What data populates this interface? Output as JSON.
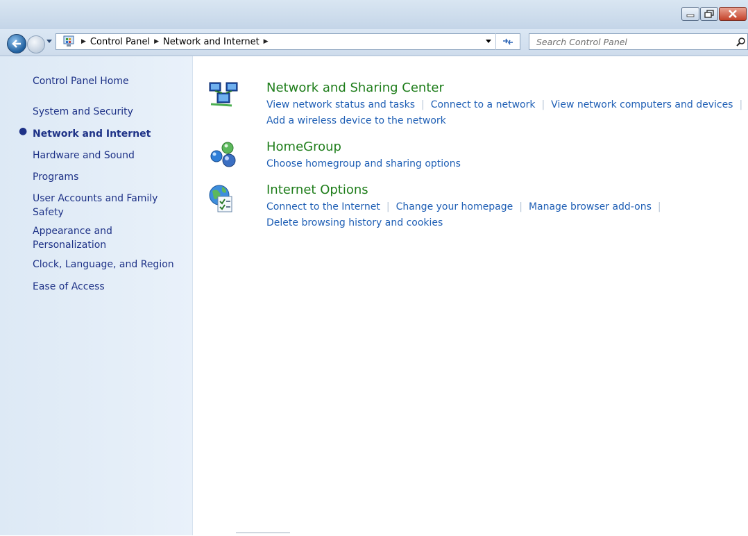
{
  "window": {
    "caption_buttons": [
      "minimize",
      "restore",
      "close"
    ]
  },
  "address": {
    "crumbs": [
      "Control Panel",
      "Network and Internet"
    ],
    "search_placeholder": "Search Control Panel"
  },
  "leftnav": {
    "items": [
      {
        "label": "Control Panel Home"
      },
      {
        "label": "System and Security"
      },
      {
        "label": "Network and Internet",
        "current": true
      },
      {
        "label": "Hardware and Sound"
      },
      {
        "label": "Programs"
      },
      {
        "label": "User Accounts and Family Safety"
      },
      {
        "label": "Appearance and Personalization"
      },
      {
        "label": "Clock, Language, and Region"
      },
      {
        "label": "Ease of Access"
      }
    ]
  },
  "categories": [
    {
      "icon": "network-sharing-icon",
      "title": "Network and Sharing Center",
      "links": [
        "View network status and tasks",
        "Connect to a network",
        "View network computers and devices",
        "Add a wireless device to the network"
      ]
    },
    {
      "icon": "homegroup-icon",
      "title": "HomeGroup",
      "links": [
        "Choose homegroup and sharing options"
      ]
    },
    {
      "icon": "internet-options-icon",
      "title": "Internet Options",
      "links": [
        "Connect to the Internet",
        "Change your homepage",
        "Manage browser add-ons",
        "Delete browsing history and cookies"
      ]
    }
  ],
  "colors": {
    "link": "#1f5fb5",
    "category_title": "#1e7d1a",
    "nav_text": "#1e3287"
  }
}
